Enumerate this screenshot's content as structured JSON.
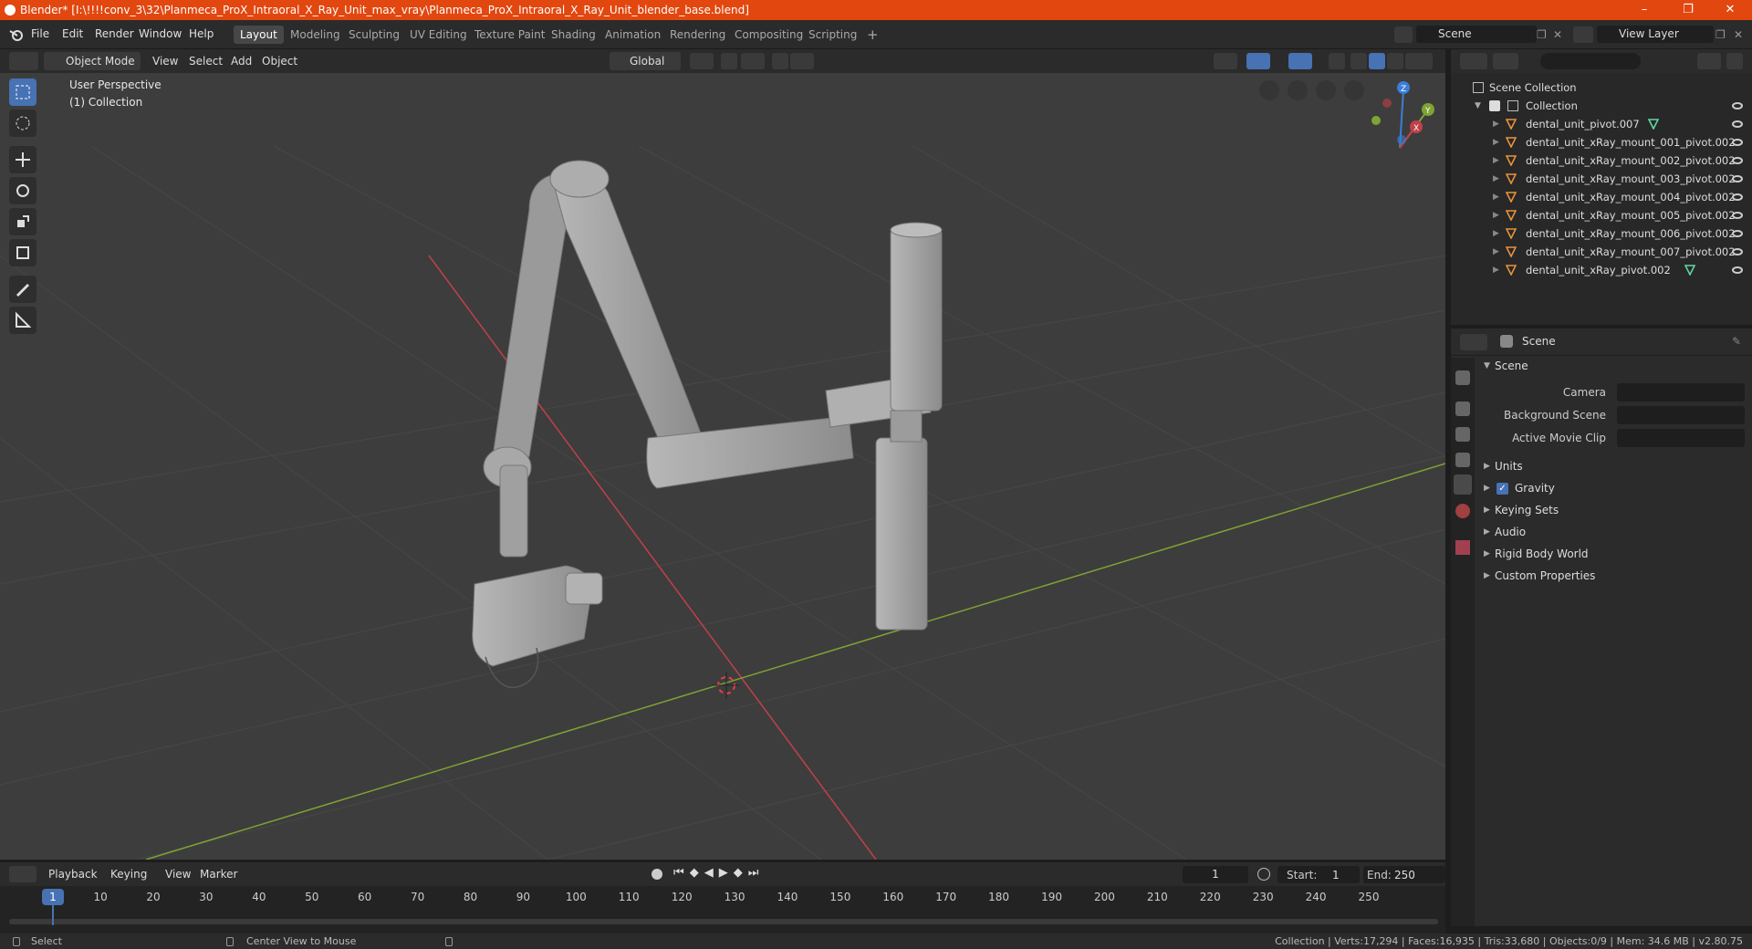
{
  "window": {
    "title": "Blender* [I:\\!!!!conv_3\\32\\Planmeca_ProX_Intraoral_X_Ray_Unit_max_vray\\Planmeca_ProX_Intraoral_X_Ray_Unit_blender_base.blend]",
    "minimize": "–",
    "restore": "❐",
    "close": "✕"
  },
  "menus": [
    "File",
    "Edit",
    "Render",
    "Window",
    "Help"
  ],
  "workspaces": [
    "Layout",
    "Modeling",
    "Sculpting",
    "UV Editing",
    "Texture Paint",
    "Shading",
    "Animation",
    "Rendering",
    "Compositing",
    "Scripting"
  ],
  "active_workspace": "Layout",
  "add_workspace": "+",
  "scene_field": "Scene",
  "view_layer_field": "View Layer",
  "viewport_header": {
    "mode": "Object Mode",
    "menus": [
      "View",
      "Select",
      "Add",
      "Object"
    ],
    "transform": "Global"
  },
  "viewport": {
    "perspective": "User Perspective",
    "collection": "(1) Collection",
    "axis_x": "X",
    "axis_y": "Y",
    "axis_z": "Z"
  },
  "outliner": {
    "root": "Scene Collection",
    "collection": "Collection",
    "items": [
      {
        "name": "dental_unit_pivot.007",
        "has_modifier": true
      },
      {
        "name": "dental_unit_xRay_mount_001_pivot.002",
        "has_modifier": false
      },
      {
        "name": "dental_unit_xRay_mount_002_pivot.002",
        "has_modifier": false
      },
      {
        "name": "dental_unit_xRay_mount_003_pivot.002",
        "has_modifier": false
      },
      {
        "name": "dental_unit_xRay_mount_004_pivot.002",
        "has_modifier": false
      },
      {
        "name": "dental_unit_xRay_mount_005_pivot.002",
        "has_modifier": false
      },
      {
        "name": "dental_unit_xRay_mount_006_pivot.002",
        "has_modifier": false
      },
      {
        "name": "dental_unit_xRay_mount_007_pivot.002",
        "has_modifier": false
      },
      {
        "name": "dental_unit_xRay_pivot.002",
        "has_modifier": true
      }
    ]
  },
  "properties": {
    "context": "Scene",
    "section": "Scene",
    "camera_label": "Camera",
    "background_scene_label": "Background Scene",
    "active_movie_clip_label": "Active Movie Clip",
    "panels": [
      {
        "label": "Units",
        "checkbox": false
      },
      {
        "label": "Gravity",
        "checkbox": true
      },
      {
        "label": "Keying Sets",
        "checkbox": false
      },
      {
        "label": "Audio",
        "checkbox": false
      },
      {
        "label": "Rigid Body World",
        "checkbox": false
      },
      {
        "label": "Custom Properties",
        "checkbox": false
      }
    ]
  },
  "timeline": {
    "menus": [
      "Playback",
      "Keying",
      "View",
      "Marker"
    ],
    "current_frame": "1",
    "start_label": "Start:",
    "start": "1",
    "end_label": "End:",
    "end": "250",
    "ticks": [
      "10",
      "20",
      "30",
      "40",
      "50",
      "60",
      "70",
      "80",
      "90",
      "100",
      "110",
      "120",
      "130",
      "140",
      "150",
      "160",
      "170",
      "180",
      "190",
      "200",
      "210",
      "220",
      "230",
      "240",
      "250"
    ],
    "ticks_frames": [
      10,
      20,
      30,
      40,
      50,
      60,
      70,
      80,
      90,
      100,
      110,
      120,
      130,
      140,
      150,
      160,
      170,
      180,
      190,
      200,
      210,
      220,
      230,
      240,
      250
    ]
  },
  "status": {
    "left": "Select",
    "middle": "Center View to Mouse",
    "right": "Collection | Verts:17,294 | Faces:16,935 | Tris:33,680 | Objects:0/9 | Mem: 34.6 MB | v2.80.75"
  },
  "colors": {
    "titlebar": "#e2470f",
    "accent": "#4772b3",
    "x_axis": "#c0404a",
    "y_axis": "#7ea433",
    "z_axis": "#3b7ed8"
  }
}
